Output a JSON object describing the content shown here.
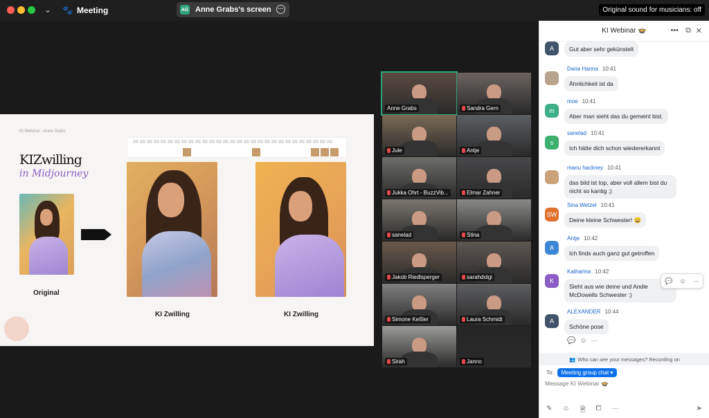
{
  "titlebar": {
    "meeting_label": "Meeting",
    "share": {
      "initials": "AG",
      "label": "Anne Grabs's screen"
    },
    "original_sound": "Original sound for musicians: off"
  },
  "slide": {
    "credit": "KI Webinar · Anne Grabs",
    "title": "KIZwilling",
    "subtitle": "in Midjourney",
    "cap_original": "Original",
    "cap_twin1": "KI Zwilling",
    "cap_twin2": "KI Zwilling"
  },
  "gallery": [
    {
      "name": "Anne Grabs",
      "muted": false,
      "active": true
    },
    {
      "name": "Sandra Gern",
      "muted": true,
      "active": false
    },
    {
      "name": "Jule",
      "muted": true,
      "active": false
    },
    {
      "name": "Antje",
      "muted": true,
      "active": false
    },
    {
      "name": "Jukka Ohrt - BuzzVib...",
      "muted": true,
      "active": false
    },
    {
      "name": "Elmar Zahner",
      "muted": true,
      "active": false
    },
    {
      "name": "sanelad",
      "muted": true,
      "active": false
    },
    {
      "name": "Stina",
      "muted": true,
      "active": false
    },
    {
      "name": "Jakob Riedlsperger",
      "muted": true,
      "active": false
    },
    {
      "name": "sarahdolgi",
      "muted": true,
      "active": false
    },
    {
      "name": "Simone Keßler",
      "muted": true,
      "active": false
    },
    {
      "name": "Laura Schmidt",
      "muted": true,
      "active": false
    },
    {
      "name": "Sirah",
      "muted": true,
      "active": false
    },
    {
      "name": "Janno",
      "muted": true,
      "active": false
    }
  ],
  "chat": {
    "title": "KI Webinar 🍲",
    "messages": [
      {
        "sender": "",
        "time": "",
        "avatar_letter": "A",
        "avatar_color": "#41536b",
        "text": "Gut aber sehr gekünstelt"
      },
      {
        "sender": "Daria Hanna",
        "time": "10:41",
        "avatar_letter": "",
        "avatar_color": "#b8a38c",
        "text": "Ähnlichkeit ist da"
      },
      {
        "sender": "moe",
        "time": "10:41",
        "avatar_letter": "m",
        "avatar_color": "#3db088",
        "text": "Aber man sieht das du gemeint bist."
      },
      {
        "sender": "sanelad",
        "time": "10:41",
        "avatar_letter": "s",
        "avatar_color": "#3db06e",
        "text": "Ich hätte dich schon wiedererkannt"
      },
      {
        "sender": "manu hackney",
        "time": "10:41",
        "avatar_letter": "",
        "avatar_color": "#c9a27a",
        "text": "das bild ist top, aber voll allem bist du nicht so kantig ;)"
      },
      {
        "sender": "Sina Wetzel",
        "time": "10:41",
        "avatar_letter": "SW",
        "avatar_color": "#e0702e",
        "text": "Deine kleine Schwester! 😄"
      },
      {
        "sender": "Antje",
        "time": "10:42",
        "avatar_letter": "A",
        "avatar_color": "#3d86d6",
        "text": "Ich finds auch ganz gut getroffen"
      },
      {
        "sender": "Katharina",
        "time": "10:42",
        "avatar_letter": "K",
        "avatar_color": "#8a5cc4",
        "text": "Sieht aus wie deine und Andie McDowells Schwester :)"
      },
      {
        "sender": "ALEXANDER",
        "time": "10:44",
        "avatar_letter": "A",
        "avatar_color": "#41536b",
        "text": "Schöne pose"
      }
    ],
    "notice": "Who can see your messages? Recording on",
    "to_label": "To:",
    "to_value": "Meeting group chat",
    "input_placeholder": "Message KI Webinar 🍲"
  }
}
